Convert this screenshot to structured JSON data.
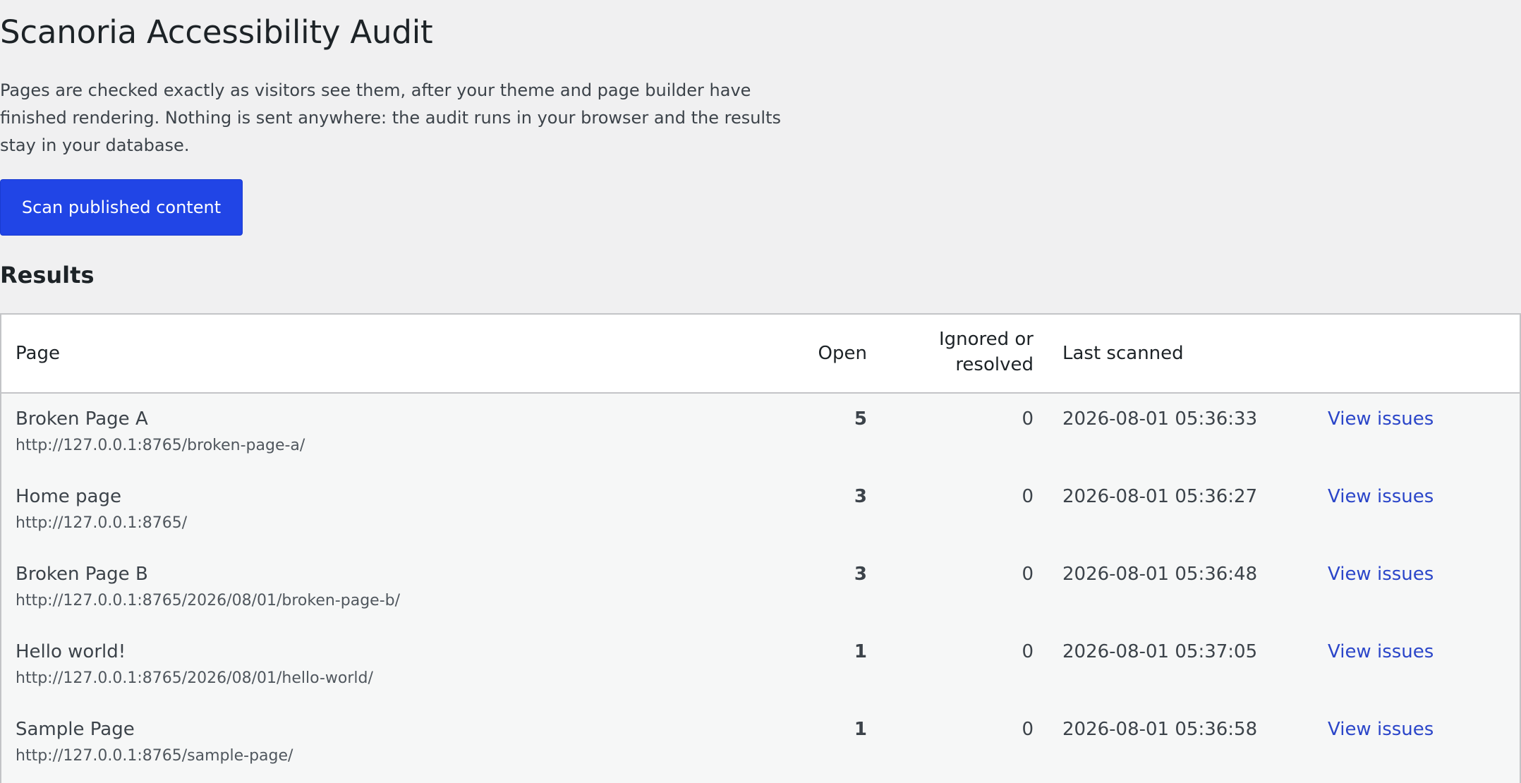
{
  "header": {
    "title": "Scanoria Accessibility Audit",
    "intro": "Pages are checked exactly as visitors see them, after your theme and page builder have finished rendering. Nothing is sent anywhere: the audit runs in your browser and the results stay in your database.",
    "scan_button_label": "Scan published content"
  },
  "results": {
    "title": "Results",
    "columns": {
      "page": "Page",
      "open": "Open",
      "ignored": "Ignored or resolved",
      "last_scanned": "Last scanned"
    },
    "rows": [
      {
        "title": "Broken Page A",
        "url": "http://127.0.0.1:8765/broken-page-a/",
        "open": "5",
        "ignored": "0",
        "last_scanned": "2026-08-01 05:36:33",
        "action": "View issues"
      },
      {
        "title": "Home page",
        "url": "http://127.0.0.1:8765/",
        "open": "3",
        "ignored": "0",
        "last_scanned": "2026-08-01 05:36:27",
        "action": "View issues"
      },
      {
        "title": "Broken Page B",
        "url": "http://127.0.0.1:8765/2026/08/01/broken-page-b/",
        "open": "3",
        "ignored": "0",
        "last_scanned": "2026-08-01 05:36:48",
        "action": "View issues"
      },
      {
        "title": "Hello world!",
        "url": "http://127.0.0.1:8765/2026/08/01/hello-world/",
        "open": "1",
        "ignored": "0",
        "last_scanned": "2026-08-01 05:37:05",
        "action": "View issues"
      },
      {
        "title": "Sample Page",
        "url": "http://127.0.0.1:8765/sample-page/",
        "open": "1",
        "ignored": "0",
        "last_scanned": "2026-08-01 05:36:58",
        "action": "View issues"
      }
    ]
  },
  "colors": {
    "accent": "#2145e6",
    "link": "#2b46c9",
    "background": "#f0f0f1"
  }
}
